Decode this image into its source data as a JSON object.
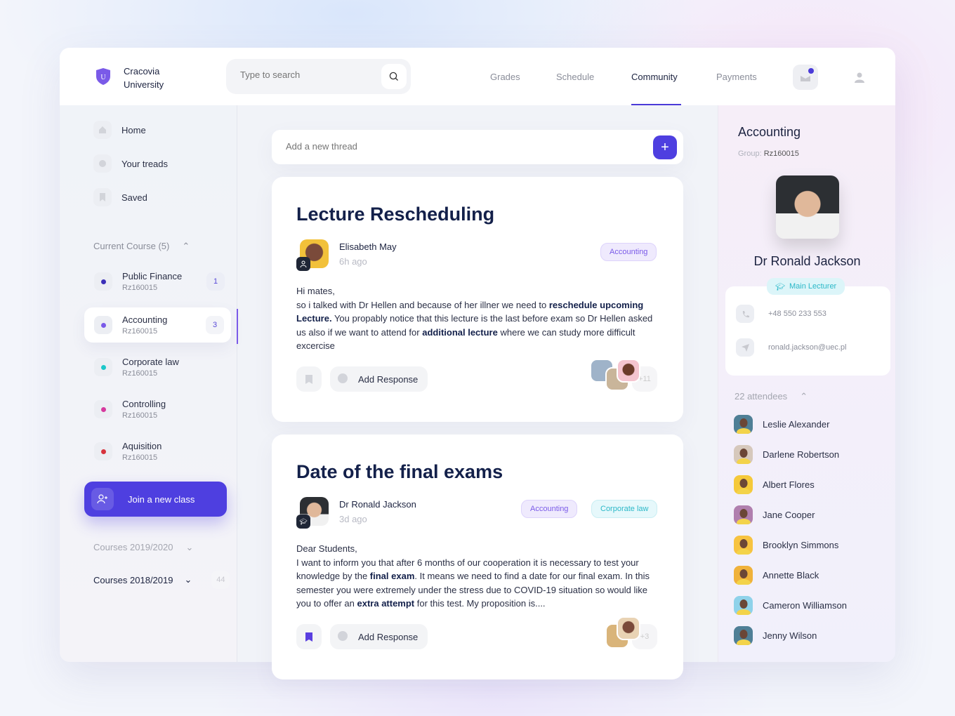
{
  "header": {
    "logo_letter": "U",
    "brand_line1": "Cracovia",
    "brand_line2": "University",
    "search_placeholder": "Type to search",
    "nav": [
      {
        "label": "Grades"
      },
      {
        "label": "Schedule"
      },
      {
        "label": "Community",
        "active": true
      },
      {
        "label": "Payments"
      }
    ],
    "icons": [
      "inbox-icon",
      "user-icon"
    ]
  },
  "sidebar": {
    "items": [
      {
        "label": "Home",
        "icon": "home-icon"
      },
      {
        "label": "Your treads",
        "icon": "chat-icon"
      },
      {
        "label": "Saved",
        "icon": "bookmark-icon"
      }
    ],
    "current_course_label": "Current Course (5)",
    "courses": [
      {
        "name": "Public Finance",
        "code": "Rz160015",
        "color": "#3b2fb8",
        "badge": "1"
      },
      {
        "name": "Accounting",
        "code": "Rz160015",
        "color": "#7a5ae8",
        "badge": "3",
        "selected": true
      },
      {
        "name": "Corporate law",
        "code": "Rz160015",
        "color": "#1cc7c9"
      },
      {
        "name": "Controlling",
        "code": "Rz160015",
        "color": "#d6399e"
      },
      {
        "name": "Aquisition",
        "code": "Rz160015",
        "color": "#d7333d"
      }
    ],
    "join_label": "Join a new class",
    "archive": [
      {
        "label": "Courses 2019/2020"
      },
      {
        "label": "Courses 2018/2019",
        "count": "44"
      }
    ]
  },
  "main": {
    "new_thread_placeholder": "Add a new thread",
    "posts": [
      {
        "title": "Lecture Rescheduling",
        "author": "Elisabeth May",
        "time": "6h ago",
        "tags": [
          "Accounting"
        ],
        "body": [
          {
            "t": "Hi mates,"
          },
          {
            "t": "so i talked with Dr Hellen and because of her illner we need to "
          },
          {
            "b": "reschedule upcoming Lecture."
          },
          {
            "t": " You propably notice that this lecture is the last before exam so Dr Hellen asked us also if we want to attend for "
          },
          {
            "b": "additional lecture"
          },
          {
            "t": " where we can study more difficult excercise"
          }
        ],
        "response_label": "Add Response",
        "more_count": "+11",
        "saved": false
      },
      {
        "title": "Date of the final exams",
        "author": "Dr Ronald Jackson",
        "time": "3d ago",
        "tags": [
          "Accounting",
          "Corporate law"
        ],
        "body": [
          {
            "t": "Dear Students,"
          },
          {
            "t": "I want to inform you that after 6 months of our cooperation it is necessary to test your knowledge by the "
          },
          {
            "b": "final exam"
          },
          {
            "t": ". It means we need to find a date for our final exam. In this semester you were extremely under the stress due to COVID-19 situation so would like you to offer an "
          },
          {
            "b": "extra attempt"
          },
          {
            "t": " for this test. My proposition is...."
          }
        ],
        "response_label": "Add Response",
        "more_count": "+3",
        "saved": true
      }
    ]
  },
  "right": {
    "course": "Accounting",
    "group_label": "Group:",
    "group": "Rz160015",
    "lecturer": "Dr Ronald Jackson",
    "role": "Main Lecturer",
    "phone": "+48 550 233 553",
    "email": "ronald.jackson@uec.pl",
    "attendees_label": "22 attendees",
    "attendees": [
      {
        "name": "Leslie Alexander",
        "color": "#4f7f96"
      },
      {
        "name": "Darlene Robertson",
        "color": "#d6c8bc"
      },
      {
        "name": "Albert Flores",
        "color": "#f5c93a"
      },
      {
        "name": "Jane Cooper",
        "color": "#b07fae"
      },
      {
        "name": "Brooklyn Simmons",
        "color": "#f7c340"
      },
      {
        "name": "Annette Black",
        "color": "#f0b23a"
      },
      {
        "name": "Cameron Williamson",
        "color": "#8fd2ea"
      },
      {
        "name": "Jenny Wilson",
        "color": "#4f7f96"
      }
    ]
  },
  "colors": {
    "accent": "#4e3fe0",
    "title": "#13204a"
  }
}
